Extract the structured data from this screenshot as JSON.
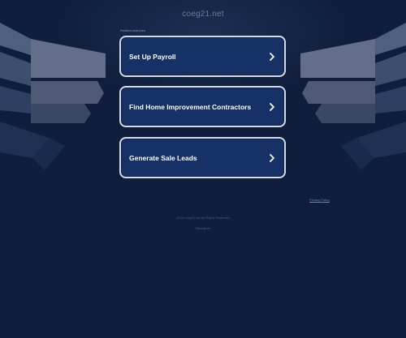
{
  "page": {
    "domain": "coeg21.net",
    "related_label": "Related searches",
    "links": [
      {
        "label": "Set Up Payroll",
        "icon": "chevron-right-icon"
      },
      {
        "label": "Find Home Improvement Contractors",
        "icon": "chevron-right-icon"
      },
      {
        "label": "Generate Sale Leads",
        "icon": "chevron-right-icon"
      }
    ],
    "privacy": "Privacy Policy",
    "copyright": "2024 coeg21.net All Rights Reserved",
    "disclaimer": "Disclaimer"
  },
  "colors": {
    "background": "#0f1e3c",
    "card_fill": "#163166",
    "card_border": "#d6dbe6",
    "text": "#ffffff"
  }
}
